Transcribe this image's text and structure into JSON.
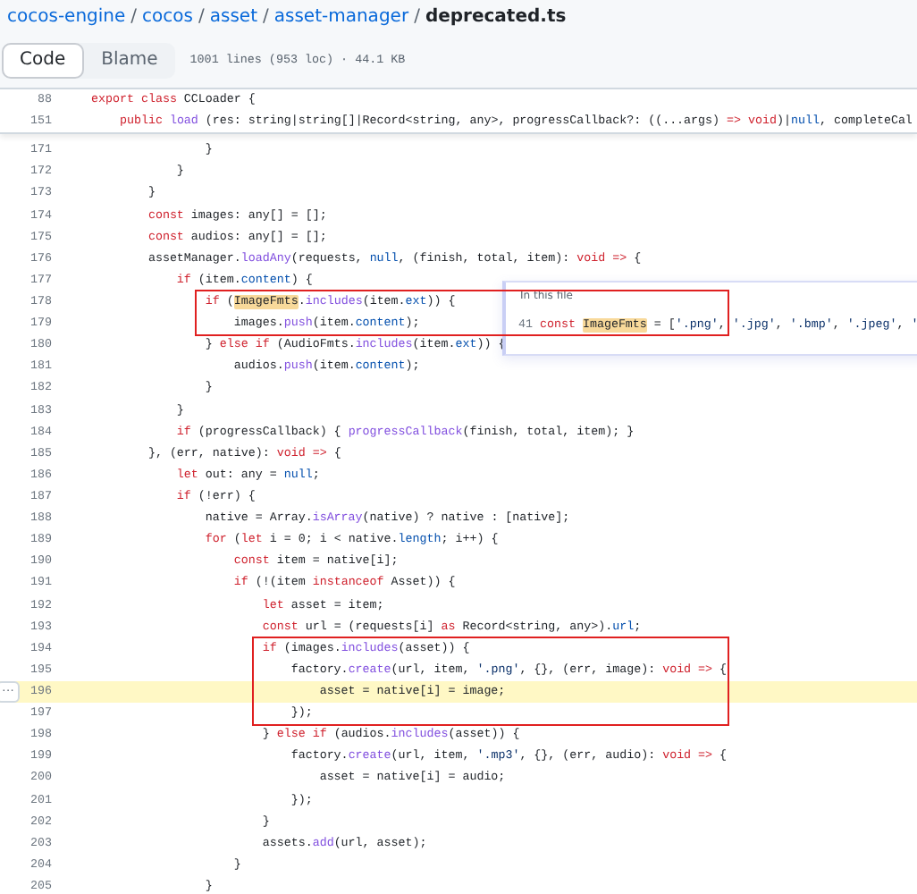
{
  "breadcrumb": {
    "links": [
      "cocos-engine",
      "cocos",
      "asset",
      "asset-manager"
    ],
    "separator": "/",
    "current": "deprecated.ts"
  },
  "tabs": [
    {
      "label": "Code",
      "selected": true
    },
    {
      "label": "Blame",
      "selected": false
    }
  ],
  "file_info": "1001 lines (953 loc) · 44.1 KB",
  "sticky_lines": [
    {
      "number": "88",
      "tokens": [
        {
          "kind": "k",
          "text": "export"
        },
        {
          "kind": "k",
          "text": " class"
        },
        {
          "kind": "t",
          "text": " CCLoader {"
        }
      ]
    },
    {
      "number": "151",
      "tokens": [
        {
          "kind": "k",
          "text": "    public"
        },
        {
          "kind": "f",
          "text": " load"
        },
        {
          "kind": "t",
          "text": " (res: string|string[]|Record<string, any>, progressCallback?: ((...args) "
        },
        {
          "kind": "k",
          "text": "=>"
        },
        {
          "kind": "k",
          "text": " void"
        },
        {
          "kind": "t",
          "text": ")|"
        },
        {
          "kind": "p",
          "text": "null"
        },
        {
          "kind": "t",
          "text": ", completeCal"
        }
      ]
    }
  ],
  "line_button": "···",
  "lines": [
    {
      "number": "171",
      "selected": false,
      "boxed": false,
      "tokens": [
        {
          "kind": "t",
          "text": "                }"
        }
      ]
    },
    {
      "number": "172",
      "selected": false,
      "boxed": false,
      "tokens": [
        {
          "kind": "t",
          "text": "            }"
        }
      ]
    },
    {
      "number": "173",
      "selected": false,
      "boxed": false,
      "tokens": [
        {
          "kind": "t",
          "text": "        }"
        }
      ]
    },
    {
      "number": "174",
      "selected": false,
      "boxed": false,
      "tokens": [
        {
          "kind": "k",
          "text": "        const"
        },
        {
          "kind": "t",
          "text": " images: any[] = [];"
        }
      ]
    },
    {
      "number": "175",
      "selected": false,
      "boxed": false,
      "tokens": [
        {
          "kind": "k",
          "text": "        const"
        },
        {
          "kind": "t",
          "text": " audios: any[] = [];"
        }
      ]
    },
    {
      "number": "176",
      "selected": false,
      "boxed": false,
      "tokens": [
        {
          "kind": "t",
          "text": "        assetManager."
        },
        {
          "kind": "f",
          "text": "loadAny"
        },
        {
          "kind": "t",
          "text": "(requests, "
        },
        {
          "kind": "p",
          "text": "null"
        },
        {
          "kind": "t",
          "text": ", (finish, total, item): "
        },
        {
          "kind": "k",
          "text": "void"
        },
        {
          "kind": "k",
          "text": " =>"
        },
        {
          "kind": "t",
          "text": " {"
        }
      ]
    },
    {
      "number": "177",
      "selected": false,
      "boxed": false,
      "tokens": [
        {
          "kind": "k",
          "text": "            if"
        },
        {
          "kind": "t",
          "text": " (item."
        },
        {
          "kind": "p",
          "text": "content"
        },
        {
          "kind": "t",
          "text": ") {"
        }
      ]
    },
    {
      "number": "178",
      "selected": false,
      "boxed": true,
      "tokens": [
        {
          "kind": "k",
          "text": "                if"
        },
        {
          "kind": "t",
          "text": " ("
        },
        {
          "kind": "m",
          "text": "ImageFmts"
        },
        {
          "kind": "t",
          "text": "."
        },
        {
          "kind": "f",
          "text": "includes"
        },
        {
          "kind": "t",
          "text": "(item."
        },
        {
          "kind": "p",
          "text": "ext"
        },
        {
          "kind": "t",
          "text": ")) {"
        }
      ]
    },
    {
      "number": "179",
      "selected": false,
      "boxed": true,
      "tokens": [
        {
          "kind": "t",
          "text": "                    images."
        },
        {
          "kind": "f",
          "text": "push"
        },
        {
          "kind": "t",
          "text": "(item."
        },
        {
          "kind": "p",
          "text": "content"
        },
        {
          "kind": "t",
          "text": ");"
        }
      ]
    },
    {
      "number": "180",
      "selected": false,
      "boxed": false,
      "tokens": [
        {
          "kind": "t",
          "text": "                } "
        },
        {
          "kind": "k",
          "text": "else if"
        },
        {
          "kind": "t",
          "text": " (AudioFmts."
        },
        {
          "kind": "f",
          "text": "includes"
        },
        {
          "kind": "t",
          "text": "(item."
        },
        {
          "kind": "p",
          "text": "ext"
        },
        {
          "kind": "t",
          "text": ")) {"
        }
      ]
    },
    {
      "number": "181",
      "selected": false,
      "boxed": false,
      "tokens": [
        {
          "kind": "t",
          "text": "                    audios."
        },
        {
          "kind": "f",
          "text": "push"
        },
        {
          "kind": "t",
          "text": "(item."
        },
        {
          "kind": "p",
          "text": "content"
        },
        {
          "kind": "t",
          "text": ");"
        }
      ]
    },
    {
      "number": "182",
      "selected": false,
      "boxed": false,
      "tokens": [
        {
          "kind": "t",
          "text": "                }"
        }
      ]
    },
    {
      "number": "183",
      "selected": false,
      "boxed": false,
      "tokens": [
        {
          "kind": "t",
          "text": "            }"
        }
      ]
    },
    {
      "number": "184",
      "selected": false,
      "boxed": false,
      "tokens": [
        {
          "kind": "k",
          "text": "            if"
        },
        {
          "kind": "t",
          "text": " (progressCallback) { "
        },
        {
          "kind": "f",
          "text": "progressCallback"
        },
        {
          "kind": "t",
          "text": "(finish, total, item); }"
        }
      ]
    },
    {
      "number": "185",
      "selected": false,
      "boxed": false,
      "tokens": [
        {
          "kind": "t",
          "text": "        }, (err, native): "
        },
        {
          "kind": "k",
          "text": "void"
        },
        {
          "kind": "k",
          "text": " =>"
        },
        {
          "kind": "t",
          "text": " {"
        }
      ]
    },
    {
      "number": "186",
      "selected": false,
      "boxed": false,
      "tokens": [
        {
          "kind": "k",
          "text": "            let"
        },
        {
          "kind": "t",
          "text": " out: any = "
        },
        {
          "kind": "p",
          "text": "null"
        },
        {
          "kind": "t",
          "text": ";"
        }
      ]
    },
    {
      "number": "187",
      "selected": false,
      "boxed": false,
      "tokens": [
        {
          "kind": "k",
          "text": "            if"
        },
        {
          "kind": "t",
          "text": " (!err) {"
        }
      ]
    },
    {
      "number": "188",
      "selected": false,
      "boxed": false,
      "tokens": [
        {
          "kind": "t",
          "text": "                native = Array."
        },
        {
          "kind": "f",
          "text": "isArray"
        },
        {
          "kind": "t",
          "text": "(native) ? native : [native];"
        }
      ]
    },
    {
      "number": "189",
      "selected": false,
      "boxed": false,
      "tokens": [
        {
          "kind": "k",
          "text": "                for"
        },
        {
          "kind": "t",
          "text": " ("
        },
        {
          "kind": "k",
          "text": "let"
        },
        {
          "kind": "t",
          "text": " i = 0; i < native."
        },
        {
          "kind": "p",
          "text": "length"
        },
        {
          "kind": "t",
          "text": "; i++) {"
        }
      ]
    },
    {
      "number": "190",
      "selected": false,
      "boxed": false,
      "tokens": [
        {
          "kind": "k",
          "text": "                    const"
        },
        {
          "kind": "t",
          "text": " item = native[i];"
        }
      ]
    },
    {
      "number": "191",
      "selected": false,
      "boxed": false,
      "tokens": [
        {
          "kind": "k",
          "text": "                    if"
        },
        {
          "kind": "t",
          "text": " (!(item "
        },
        {
          "kind": "k",
          "text": "instanceof"
        },
        {
          "kind": "t",
          "text": " Asset)) {"
        }
      ]
    },
    {
      "number": "192",
      "selected": false,
      "boxed": false,
      "tokens": [
        {
          "kind": "k",
          "text": "                        let"
        },
        {
          "kind": "t",
          "text": " asset = item;"
        }
      ]
    },
    {
      "number": "193",
      "selected": false,
      "boxed": false,
      "tokens": [
        {
          "kind": "k",
          "text": "                        const"
        },
        {
          "kind": "t",
          "text": " url = (requests[i] "
        },
        {
          "kind": "k",
          "text": "as"
        },
        {
          "kind": "t",
          "text": " Record<string, any>)."
        },
        {
          "kind": "p",
          "text": "url"
        },
        {
          "kind": "t",
          "text": ";"
        }
      ]
    },
    {
      "number": "194",
      "selected": false,
      "boxed": true,
      "tokens": [
        {
          "kind": "k",
          "text": "                        if"
        },
        {
          "kind": "t",
          "text": " (images."
        },
        {
          "kind": "f",
          "text": "includes"
        },
        {
          "kind": "t",
          "text": "(asset)) {"
        }
      ]
    },
    {
      "number": "195",
      "selected": false,
      "boxed": true,
      "tokens": [
        {
          "kind": "t",
          "text": "                            factory."
        },
        {
          "kind": "f",
          "text": "create"
        },
        {
          "kind": "t",
          "text": "(url, item, "
        },
        {
          "kind": "s",
          "text": "'.png'"
        },
        {
          "kind": "t",
          "text": ", {}, (err, image): "
        },
        {
          "kind": "k",
          "text": "void"
        },
        {
          "kind": "k",
          "text": " =>"
        },
        {
          "kind": "t",
          "text": " {"
        }
      ]
    },
    {
      "number": "196",
      "selected": true,
      "boxed": true,
      "tokens": [
        {
          "kind": "t",
          "text": "                                asset = native[i] = image;"
        }
      ]
    },
    {
      "number": "197",
      "selected": false,
      "boxed": true,
      "tokens": [
        {
          "kind": "t",
          "text": "                            });"
        }
      ]
    },
    {
      "number": "198",
      "selected": false,
      "boxed": false,
      "tokens": [
        {
          "kind": "t",
          "text": "                        } "
        },
        {
          "kind": "k",
          "text": "else if"
        },
        {
          "kind": "t",
          "text": " (audios."
        },
        {
          "kind": "f",
          "text": "includes"
        },
        {
          "kind": "t",
          "text": "(asset)) {"
        }
      ]
    },
    {
      "number": "199",
      "selected": false,
      "boxed": false,
      "tokens": [
        {
          "kind": "t",
          "text": "                            factory."
        },
        {
          "kind": "f",
          "text": "create"
        },
        {
          "kind": "t",
          "text": "(url, item, "
        },
        {
          "kind": "s",
          "text": "'.mp3'"
        },
        {
          "kind": "t",
          "text": ", {}, (err, audio): "
        },
        {
          "kind": "k",
          "text": "void"
        },
        {
          "kind": "k",
          "text": " =>"
        },
        {
          "kind": "t",
          "text": " {"
        }
      ]
    },
    {
      "number": "200",
      "selected": false,
      "boxed": false,
      "tokens": [
        {
          "kind": "t",
          "text": "                                asset = native[i] = audio;"
        }
      ]
    },
    {
      "number": "201",
      "selected": false,
      "boxed": false,
      "tokens": [
        {
          "kind": "t",
          "text": "                            });"
        }
      ]
    },
    {
      "number": "202",
      "selected": false,
      "boxed": false,
      "tokens": [
        {
          "kind": "t",
          "text": "                        }"
        }
      ]
    },
    {
      "number": "203",
      "selected": false,
      "boxed": false,
      "tokens": [
        {
          "kind": "t",
          "text": "                        assets."
        },
        {
          "kind": "f",
          "text": "add"
        },
        {
          "kind": "t",
          "text": "(url, asset);"
        }
      ]
    },
    {
      "number": "204",
      "selected": false,
      "boxed": false,
      "tokens": [
        {
          "kind": "t",
          "text": "                    }"
        }
      ]
    },
    {
      "number": "205",
      "selected": false,
      "boxed": false,
      "tokens": [
        {
          "kind": "t",
          "text": "                }"
        }
      ]
    }
  ],
  "symbol_popup": {
    "heading": "In this file",
    "line_number": "41",
    "tokens": [
      {
        "kind": "k",
        "text": "const"
      },
      {
        "kind": "m",
        "text": "ImageFmts"
      },
      {
        "kind": "t",
        "text": " = ["
      },
      {
        "kind": "s",
        "text": "'.png'"
      },
      {
        "kind": "t",
        "text": ", "
      },
      {
        "kind": "s",
        "text": "'.jpg'"
      },
      {
        "kind": "t",
        "text": ", "
      },
      {
        "kind": "s",
        "text": "'.bmp'"
      },
      {
        "kind": "t",
        "text": ", "
      },
      {
        "kind": "s",
        "text": "'.jpeg'"
      },
      {
        "kind": "t",
        "text": ", "
      },
      {
        "kind": "s",
        "text": "'"
      }
    ]
  }
}
